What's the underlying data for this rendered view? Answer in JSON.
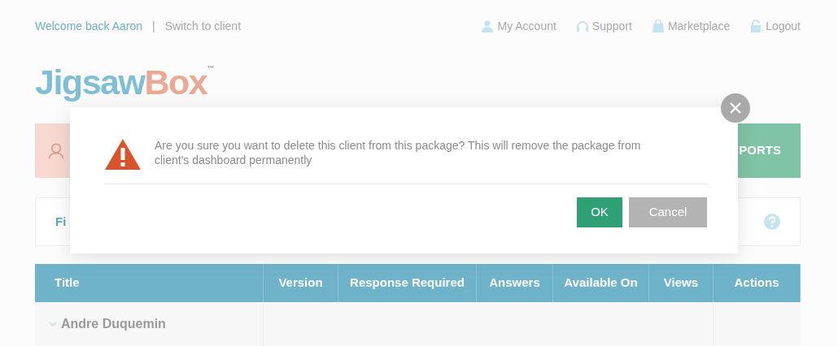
{
  "header": {
    "welcome": "Welcome back Aaron",
    "separator": "|",
    "switch_link": "Switch to client",
    "nav": [
      {
        "label": "My Account"
      },
      {
        "label": "Support"
      },
      {
        "label": "Marketplace"
      },
      {
        "label": "Logout"
      }
    ]
  },
  "logo": {
    "part_1": "Jigsaw",
    "part_2": "Box",
    "mark": "™"
  },
  "tabs_bar": {
    "right_tab": "PORTS"
  },
  "filter": {
    "label": "Fi"
  },
  "table": {
    "columns": [
      "Title",
      "Version",
      "Response Required",
      "Answers",
      "Available On",
      "Views",
      "Actions"
    ],
    "rows": [
      {
        "title": "Andre Duquemin",
        "expanded": true
      }
    ]
  },
  "dialog": {
    "message": "Are you sure you want to delete this client from this package? This will remove the package from client's dashboard permanently",
    "buttons": [
      {
        "label": "OK",
        "kind": "primary"
      },
      {
        "label": "Cancel",
        "kind": "secondary"
      }
    ]
  }
}
